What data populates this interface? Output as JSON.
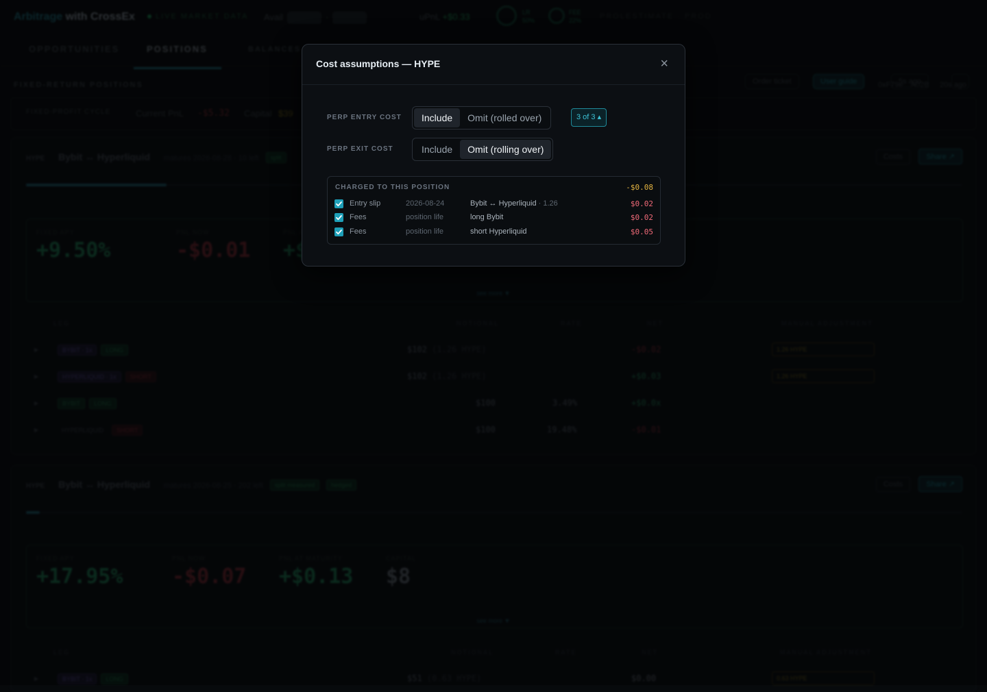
{
  "app": {
    "brand_a": "Arbitrage",
    "brand_b": "with CrossEx",
    "live_label": "LIVE MARKET DATA",
    "avail_label": "Avail",
    "upnl_label": "uPnL",
    "upnl_value": "+$0.33",
    "ring1_label": "LR",
    "ring1_value": "50%",
    "ring2_label": "FEE",
    "ring2_value": "22%",
    "top_right_text": "PROLESTIMATE · PROD"
  },
  "tabs": [
    {
      "label": "OPPORTUNITIES"
    },
    {
      "label": "POSITIONS",
      "active": true
    },
    {
      "label": "BALANCES"
    }
  ],
  "toolbar": {
    "order_ticket": "Order ticket",
    "user_guide": "User guide",
    "refresh": "5s ago"
  },
  "section": {
    "label": "FIXED-RETURN POSITIONS",
    "wallet": "0xF79e…A02B",
    "updated": "20s ago"
  },
  "summary": {
    "label": "FIXED-PROFIT CYCLE",
    "current_pnl_label": "Current PnL",
    "current_pnl_value": "-$5.32",
    "capital_label": "Capital",
    "capital_value": "$39"
  },
  "cards": [
    {
      "asset": "HYPE",
      "route": "Bybit ↔ Hyperliquid",
      "matures": "matures 2026-08-28 · 10 left",
      "badges": [
        "split"
      ],
      "costs_btn": "Costs",
      "share_btn": "Share ↗",
      "progress": 0.15,
      "metrics": [
        {
          "label": "FIXED APY",
          "value": "+9.50%",
          "tone": "pos"
        },
        {
          "label": "PNL NOW",
          "value": "-$0.01",
          "tone": "neg"
        },
        {
          "label": "PNL AT MATURITY",
          "value": "+$",
          "tone": "pos"
        }
      ],
      "see_more": "see more ▼",
      "columns": [
        "LEG",
        "NOTIONAL",
        "RATE",
        "NET",
        "MANUAL ADJUSTMENT"
      ],
      "rows": [
        {
          "leg": "BYBIT · 1x",
          "side": "LONG",
          "notional": "$102",
          "qty": "(1.26 HYPE)",
          "rate": "",
          "net": "-$0.02",
          "adj": "1.26 HYPE"
        },
        {
          "leg": "HYPERLIQUID · 1x",
          "side": "SHORT",
          "notional": "$102",
          "qty": "(1.26 HYPE)",
          "rate": "",
          "net": "+$0.03",
          "adj": "1.26 HYPE"
        },
        {
          "leg": "BYBIT",
          "side": "LONG",
          "notional": "$100",
          "qty": "",
          "rate": "3.49%",
          "net": "+$0.0x",
          "adj": ""
        },
        {
          "leg": "HYPERLIQUID",
          "side": "SHORT",
          "notional": "$100",
          "qty": "",
          "rate": "19.48%",
          "net": "-$0.01",
          "adj": ""
        }
      ]
    },
    {
      "asset": "HYPE",
      "route": "Bybit ↔ Hyperliquid",
      "matures": "matures 2026-08-25 · 202 left",
      "badges": [
        "split measured",
        "hedged"
      ],
      "costs_btn": "Costs",
      "share_btn": "Share ↗",
      "progress": 0.015,
      "metrics": [
        {
          "label": "FIXED APY",
          "value": "+17.95%",
          "tone": "pos"
        },
        {
          "label": "PNL NOW",
          "value": "-$0.07",
          "tone": "neg"
        },
        {
          "label": "PNL AT MATURITY",
          "value": "+$0.13",
          "tone": "pos"
        },
        {
          "label": "CAPITAL",
          "value": "$8",
          "tone": "gray"
        }
      ],
      "see_more": "see more ▼",
      "columns": [
        "LEG",
        "NOTIONAL",
        "RATE",
        "NET",
        "MANUAL ADJUSTMENT"
      ],
      "rows": [
        {
          "leg": "BYBIT · 1x",
          "side": "LONG",
          "notional": "$51",
          "qty": "(0.63 HYPE)",
          "rate": "",
          "net": "$0.00",
          "adj": "0.63 HYPE"
        }
      ]
    }
  ],
  "modal": {
    "title": "Cost assumptions — HYPE",
    "close_label": "×",
    "entry": {
      "label": "PERP ENTRY COST",
      "options": [
        "Include",
        "Omit (rolled over)"
      ],
      "selected": 0,
      "counter": "3 of 3 ▴"
    },
    "exit": {
      "label": "PERP EXIT COST",
      "options": [
        "Include",
        "Omit (rolling over)"
      ],
      "selected": 1
    },
    "charged": {
      "title": "CHARGED TO THIS POSITION",
      "total": "-$0.08",
      "rows": [
        {
          "checked": true,
          "type": "Entry slip",
          "when": "2026-08-24",
          "desc": "Bybit ↔ Hyperliquid",
          "desc_sub": "· 1.26",
          "amount": "$0.02"
        },
        {
          "checked": true,
          "type": "Fees",
          "when": "position life",
          "desc": "long Bybit",
          "desc_sub": "",
          "amount": "$0.02"
        },
        {
          "checked": true,
          "type": "Fees",
          "when": "position life",
          "desc": "short Hyperliquid",
          "desc_sub": "",
          "amount": "$0.05"
        }
      ]
    }
  },
  "colors": {
    "accent": "#1e9fb8",
    "positive": "#1f9c5a",
    "negative": "#f06a78",
    "warning": "#e3b341"
  }
}
